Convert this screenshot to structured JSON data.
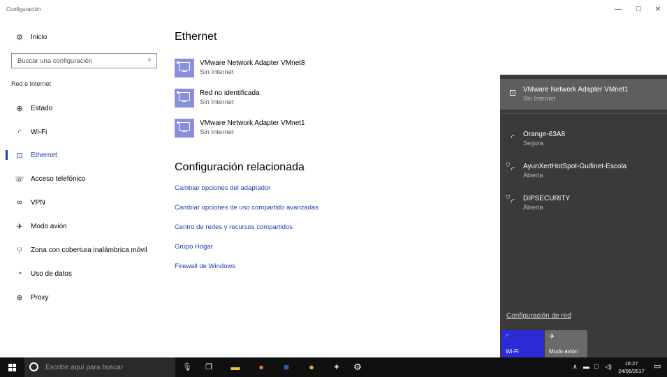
{
  "window": {
    "title": "Configuración",
    "minimize": "—",
    "maximize": "☐",
    "close": "✕"
  },
  "sidebar": {
    "home_label": "Inicio",
    "search_placeholder": "Buscar una configuración",
    "section_label": "Red e Internet",
    "items": [
      {
        "label": "Estado",
        "icon": "status-icon",
        "active": false
      },
      {
        "label": "Wi-Fi",
        "icon": "wifi-icon",
        "active": false
      },
      {
        "label": "Ethernet",
        "icon": "ethernet-icon",
        "active": true
      },
      {
        "label": "Acceso telefónico",
        "icon": "dialup-icon",
        "active": false
      },
      {
        "label": "VPN",
        "icon": "vpn-icon",
        "active": false
      },
      {
        "label": "Modo avión",
        "icon": "airplane-icon",
        "active": false
      },
      {
        "label": "Zona con cobertura inalámbrica móvil",
        "icon": "hotspot-icon",
        "active": false
      },
      {
        "label": "Uso de datos",
        "icon": "data-usage-icon",
        "active": false
      },
      {
        "label": "Proxy",
        "icon": "proxy-icon",
        "active": false
      }
    ]
  },
  "main": {
    "title": "Ethernet",
    "adapters": [
      {
        "name": "VMware Network Adapter VMnet8",
        "status": "Sin Internet"
      },
      {
        "name": "Red no identificada",
        "status": "Sin Internet"
      },
      {
        "name": "VMware Network Adapter VMnet1",
        "status": "Sin Internet"
      }
    ],
    "related_title": "Configuración relacionada",
    "related_links": [
      "Cambiar opciones del adaptador",
      "Cambiar opciones de uso compartido avanzadas",
      "Centro de redes y recursos compartidos",
      "Grupo Hogar",
      "Firewall de Windows"
    ]
  },
  "flyout": {
    "networks": [
      {
        "name": "VMware Network Adapter VMnet1",
        "status": "Sin Internet",
        "type": "ethernet",
        "connected": true
      },
      {
        "name": "Orange-63A8",
        "status": "Segura",
        "type": "wifi",
        "connected": false
      },
      {
        "name": "AyunXertHotSpot-Guifinet-Escola",
        "status": "Abierta",
        "type": "wifi-open",
        "connected": false
      },
      {
        "name": "DIPSECURITY",
        "status": "Abierta",
        "type": "wifi-open",
        "connected": false
      }
    ],
    "config_link": "Configuración de red",
    "tiles": [
      {
        "label": "Wi-Fi",
        "active": true
      },
      {
        "label": "Modo avión",
        "active": false
      }
    ]
  },
  "taskbar": {
    "search_placeholder": "Escribe aquí para buscar",
    "apps": [
      "microphone-icon",
      "task-view-icon",
      "file-explorer-icon",
      "firefox-icon",
      "word-icon",
      "chrome-icon",
      "network-app-icon",
      "settings-icon"
    ],
    "time": "16:27",
    "date": "24/06/2017"
  },
  "colors": {
    "accent": "#1a3cb5",
    "adapter_icon": "#8a8fdc",
    "flyout_bg": "#3a3a3a",
    "flyout_connected": "#5e5e5e",
    "wifi_tile": "#2b2bd8",
    "taskbar": "#101010"
  }
}
